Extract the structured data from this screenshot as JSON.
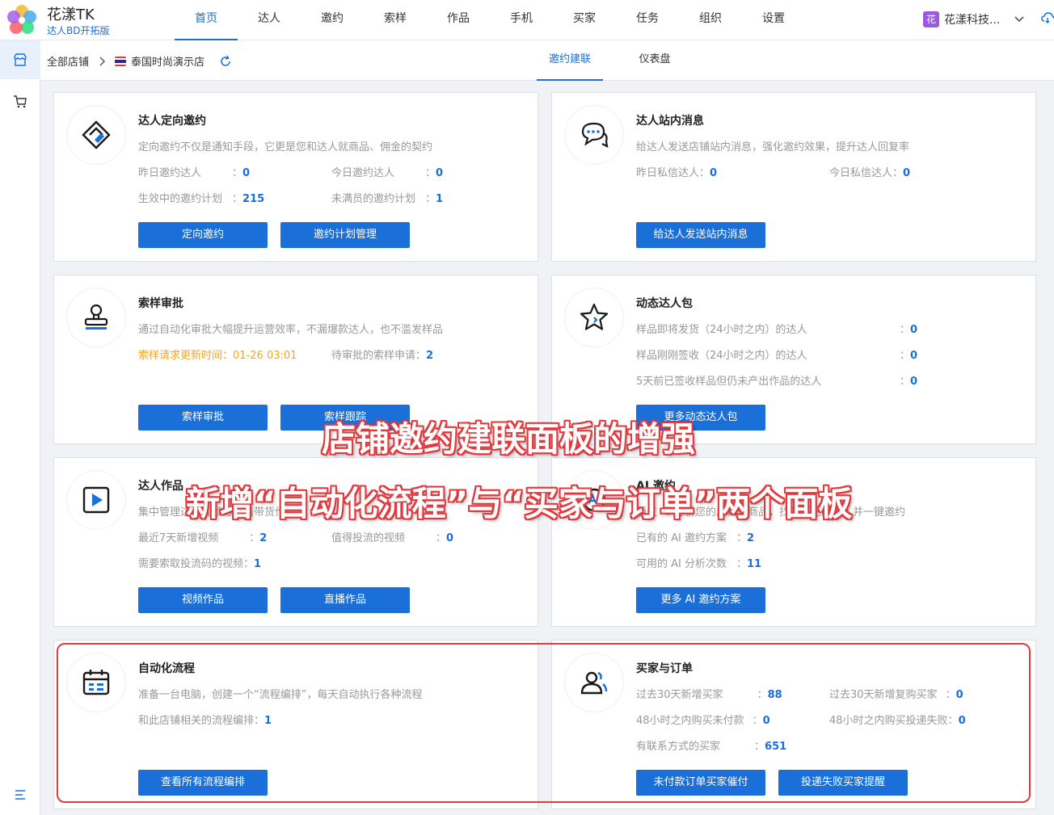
{
  "app": {
    "title": "花漾TK",
    "subtitle": "达人BD开拓版"
  },
  "nav": [
    "首页",
    "达人",
    "邀约",
    "索样",
    "作品",
    "手机",
    "买家",
    "任务",
    "组织",
    "设置"
  ],
  "org": {
    "badge": "花",
    "name": "花漾科技..."
  },
  "breadcrumb": {
    "root": "全部店铺",
    "shop": "泰国时尚演示店"
  },
  "subtabs": [
    "邀约建联",
    "仪表盘"
  ],
  "cards": {
    "invite": {
      "title": "达人定向邀约",
      "desc": "定向邀约不仅是通知手段，它更是您和达人就商品、佣金的契约",
      "stats": [
        {
          "label": "昨日邀约达人",
          "value": "0"
        },
        {
          "label": "今日邀约达人",
          "value": "0"
        },
        {
          "label": "生效中的邀约计划",
          "value": "215"
        },
        {
          "label": "未满员的邀约计划",
          "value": "1"
        }
      ],
      "buttons": [
        "定向邀约",
        "邀约计划管理"
      ]
    },
    "message": {
      "title": "达人站内消息",
      "desc": "给达人发送店铺站内消息，强化邀约效果，提升达人回复率",
      "stats": [
        {
          "label": "昨日私信达人",
          "value": "0"
        },
        {
          "label": "今日私信达人",
          "value": "0"
        }
      ],
      "buttons": [
        "给达人发送站内消息"
      ]
    },
    "sample": {
      "title": "索样审批",
      "desc": "通过自动化审批大幅提升运营效率，不漏爆款达人，也不滥发样品",
      "stats": [
        {
          "label": "索样请求更新时间",
          "value": "01-26 03:01"
        },
        {
          "label": "待审批的索样申请",
          "value": "2"
        }
      ],
      "buttons": [
        "索样审批",
        "索样跟踪"
      ]
    },
    "dynamic": {
      "title": "动态达人包",
      "stats": [
        {
          "label": "样品即将发货（24小时之内）的达人",
          "value": "0"
        },
        {
          "label": "样品刚刚签收（24小时之内）的达人",
          "value": "0"
        },
        {
          "label": "5天前已签收样品但仍未产出作品的达人",
          "value": "0"
        }
      ],
      "buttons": [
        "更多动态达人包"
      ]
    },
    "video": {
      "title": "达人作品",
      "desc": "集中管理达人视频与直播带货作品",
      "stats": [
        {
          "label": "最近7天新增视频",
          "value": "2"
        },
        {
          "label": "值得投流的视频",
          "value": "0"
        },
        {
          "label": "需要索取投流码的视频",
          "value": "1"
        }
      ],
      "buttons": [
        "视频作品",
        "直播作品"
      ]
    },
    "ai": {
      "title": "AI 邀约",
      "desc": "通过 AI 分析您的店铺与商品，找到匹配的达人并一键邀约",
      "stats": [
        {
          "label": "已有的 AI 邀约方案",
          "value": "2"
        },
        {
          "label": "可用的 AI 分析次数",
          "value": "11"
        }
      ],
      "buttons": [
        "更多 AI 邀约方案"
      ]
    },
    "automation": {
      "title": "自动化流程",
      "desc": "准备一台电脑，创建一个“流程编排”，每天自动执行各种流程",
      "stats": [
        {
          "label": "和此店铺相关的流程编排",
          "value": "1"
        }
      ],
      "buttons": [
        "查看所有流程编排"
      ]
    },
    "buyers": {
      "title": "买家与订单",
      "stats": [
        {
          "label": "过去30天新增买家",
          "value": "88"
        },
        {
          "label": "过去30天新增复购买家",
          "value": "0"
        },
        {
          "label": "48小时之内购买未付款",
          "value": "0"
        },
        {
          "label": "48小时之内购买投递失败",
          "value": "0"
        },
        {
          "label": "有联系方式的买家",
          "value": "651"
        }
      ],
      "buttons": [
        "未付款订单买家催付",
        "投递失败买家提醒"
      ]
    }
  },
  "overlay": {
    "line1": "店铺邀约建联面板的增强",
    "line2": "新增“自动化流程”与“买家与订单”两个面板"
  },
  "colors": {
    "accent": "#1a6fd8",
    "warning": "#f5a623",
    "highlight": "#e0393e"
  }
}
